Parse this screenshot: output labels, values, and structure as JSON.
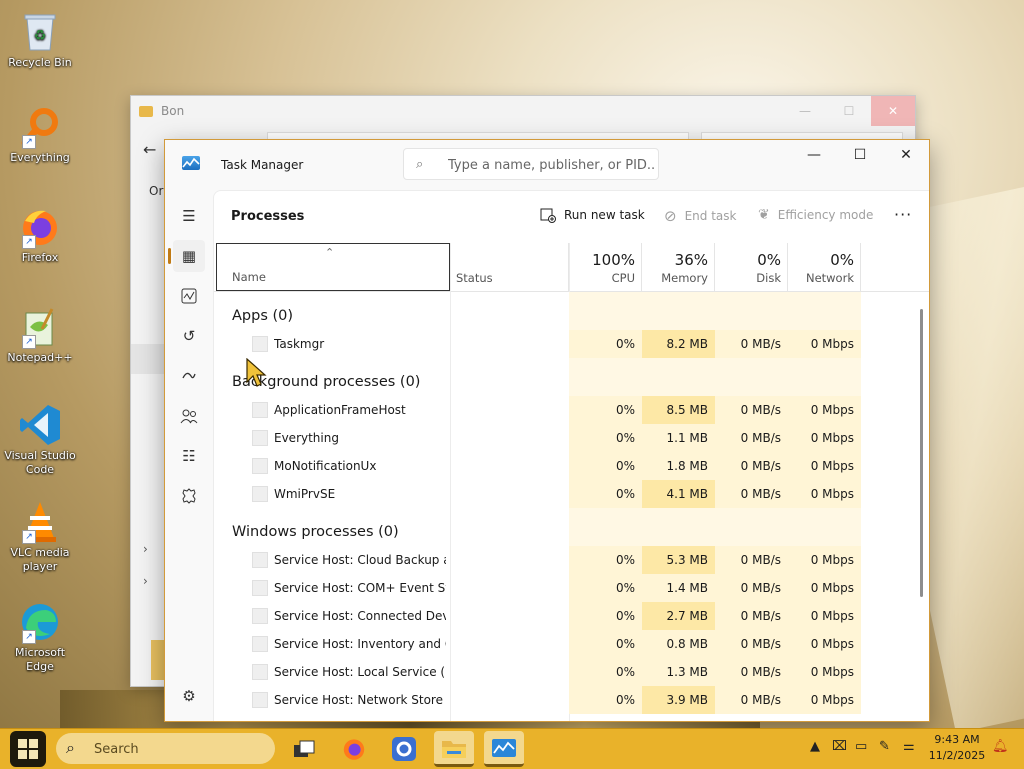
{
  "desktop": {
    "icons": [
      {
        "label": "Recycle Bin"
      },
      {
        "label": "Everything"
      },
      {
        "label": "Firefox"
      },
      {
        "label": "Notepad++"
      },
      {
        "label": "Visual Studio Code"
      },
      {
        "label": "VLC media player"
      },
      {
        "label": "Microsoft Edge"
      }
    ]
  },
  "back_window": {
    "title": "Bon",
    "crumb": "Or"
  },
  "task_manager": {
    "title": "Task Manager",
    "search_placeholder": "Type a name, publisher, or PID...",
    "page_title": "Processes",
    "commands": {
      "run_new_task": "Run new task",
      "end_task": "End task",
      "efficiency_mode": "Efficiency mode",
      "more": "···"
    },
    "columns": {
      "name": "Name",
      "status": "Status",
      "cpu": {
        "pct": "100%",
        "label": "CPU"
      },
      "memory": {
        "pct": "36%",
        "label": "Memory"
      },
      "disk": {
        "pct": "0%",
        "label": "Disk"
      },
      "network": {
        "pct": "0%",
        "label": "Network"
      }
    },
    "groups": [
      {
        "title": "Apps (0)",
        "rows": [
          {
            "name": "Taskmgr",
            "cpu": "0%",
            "memory": "8.2 MB",
            "disk": "0 MB/s",
            "network": "0 Mbps"
          }
        ]
      },
      {
        "title": "Background processes (0)",
        "rows": [
          {
            "name": "ApplicationFrameHost",
            "cpu": "0%",
            "memory": "8.5 MB",
            "disk": "0 MB/s",
            "network": "0 Mbps"
          },
          {
            "name": "Everything",
            "cpu": "0%",
            "memory": "1.1 MB",
            "disk": "0 MB/s",
            "network": "0 Mbps"
          },
          {
            "name": "MoNotificationUx",
            "cpu": "0%",
            "memory": "1.8 MB",
            "disk": "0 MB/s",
            "network": "0 Mbps"
          },
          {
            "name": "WmiPrvSE",
            "cpu": "0%",
            "memory": "4.1 MB",
            "disk": "0 MB/s",
            "network": "0 Mbps"
          }
        ]
      },
      {
        "title": "Windows processes (0)",
        "rows": [
          {
            "name": "Service Host: Cloud Backup a...",
            "cpu": "0%",
            "memory": "5.3 MB",
            "disk": "0 MB/s",
            "network": "0 Mbps"
          },
          {
            "name": "Service Host: COM+ Event Sys...",
            "cpu": "0%",
            "memory": "1.4 MB",
            "disk": "0 MB/s",
            "network": "0 Mbps"
          },
          {
            "name": "Service Host: Connected Devi...",
            "cpu": "0%",
            "memory": "2.7 MB",
            "disk": "0 MB/s",
            "network": "0 Mbps"
          },
          {
            "name": "Service Host: Inventory and C...",
            "cpu": "0%",
            "memory": "0.8 MB",
            "disk": "0 MB/s",
            "network": "0 Mbps"
          },
          {
            "name": "Service Host: Local Service (N...",
            "cpu": "0%",
            "memory": "1.3 MB",
            "disk": "0 MB/s",
            "network": "0 Mbps"
          },
          {
            "name": "Service Host: Network Store In...",
            "cpu": "0%",
            "memory": "3.9 MB",
            "disk": "0 MB/s",
            "network": "0 Mbps"
          }
        ]
      }
    ]
  },
  "taskbar": {
    "search_placeholder": "Search",
    "clock_time": "9:43 AM",
    "clock_date": "11/2/2025"
  },
  "colors": {
    "accent": "#c07a14",
    "taskbar": "#e9b22a",
    "heat_light": "#fff5d6",
    "heat_strong": "#fde8a6"
  }
}
